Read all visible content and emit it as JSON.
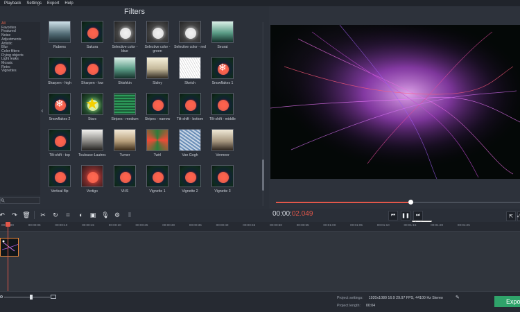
{
  "menu": [
    "Playback",
    "Settings",
    "Export",
    "Help"
  ],
  "filters_title": "Filters",
  "categories": [
    {
      "label": "All",
      "active": true
    },
    {
      "label": "Favorites"
    },
    {
      "label": "Featured"
    },
    {
      "label": "Noise"
    },
    {
      "label": "Adjustments"
    },
    {
      "label": "Artistic"
    },
    {
      "label": "Blur"
    },
    {
      "label": "Color filters"
    },
    {
      "label": "Flying objects"
    },
    {
      "label": "Light leaks"
    },
    {
      "label": "Mosaic"
    },
    {
      "label": "Retro"
    },
    {
      "label": "Vignettes"
    }
  ],
  "filters": [
    {
      "label": "Rubens",
      "style": "gradient-blue"
    },
    {
      "label": "Sakura",
      "style": "flower"
    },
    {
      "label": "Selective color - blue",
      "style": "flower-gray"
    },
    {
      "label": "Selective color - green",
      "style": "flower-gray"
    },
    {
      "label": "Selective color - red",
      "style": "flower-gray"
    },
    {
      "label": "Seurat",
      "style": "gradient-teal"
    },
    {
      "label": "Sharpen - high",
      "style": "flower"
    },
    {
      "label": "Sharpen - low",
      "style": "flower"
    },
    {
      "label": "Shishkin",
      "style": "gradient-teal"
    },
    {
      "label": "Sisley",
      "style": "gradient-cream"
    },
    {
      "label": "Sketch",
      "style": "sketch"
    },
    {
      "label": "Snowflakes 1",
      "style": "flower"
    },
    {
      "label": "Snowflakes 2",
      "style": "flower"
    },
    {
      "label": "Stars",
      "style": "flower-green"
    },
    {
      "label": "Stripes - medium",
      "style": "stripes"
    },
    {
      "label": "Stripes - narrow",
      "style": "flower"
    },
    {
      "label": "Tilt-shift - bottom",
      "style": "flower"
    },
    {
      "label": "Tilt-shift - middle",
      "style": "flower"
    },
    {
      "label": "Tilt-shift - top",
      "style": "flower"
    },
    {
      "label": "Toulouse-Lautrec",
      "style": "gradient-gray"
    },
    {
      "label": "Turner",
      "style": "gradient-sepia"
    },
    {
      "label": "Twirl",
      "style": "twirl"
    },
    {
      "label": "Van Gogh",
      "style": "vangogh"
    },
    {
      "label": "Vermeer",
      "style": "gradient-warm"
    },
    {
      "label": "Vertical flip",
      "style": "flower"
    },
    {
      "label": "Vertigo",
      "style": "flower-red"
    },
    {
      "label": "VHS",
      "style": "flower"
    },
    {
      "label": "Vignette 1",
      "style": "flower"
    },
    {
      "label": "Vignette 2",
      "style": "flower"
    },
    {
      "label": "Vignette 3",
      "style": "flower"
    }
  ],
  "player": {
    "timecode_main": "00:00:",
    "timecode_red": "02.049",
    "progress": 0.55,
    "tooltip": "Play / Pause"
  },
  "timeline_ticks": [
    "00:00:00",
    "00:00:05",
    "00:00:10",
    "00:00:15",
    "00:00:20",
    "00:00:25",
    "00:00:30",
    "00:00:35",
    "00:00:40",
    "00:00:45",
    "00:00:50",
    "00:00:55",
    "00:01:00",
    "00:01:05",
    "00:01:10",
    "00:01:15",
    "00:01:20",
    "00:01:25"
  ],
  "project": {
    "settings_label": "Project settings:",
    "settings_value": "1920x1080 16:9 29.97 FPS, 44100 Hz Stereo",
    "length_label": "Project length:",
    "length_value": "00:04"
  },
  "export_label": "Export",
  "colors": {
    "accent": "#e2574a",
    "export": "#2fa36a"
  },
  "icons": [
    "search-icon",
    "undo-icon",
    "redo-icon",
    "delete-icon",
    "cut-icon",
    "rotate-icon",
    "crop-icon",
    "color-adjust-icon",
    "image-icon",
    "mic-icon",
    "settings-icon",
    "audio-levels-icon",
    "prev-icon",
    "pause-icon",
    "next-icon",
    "external-window-icon",
    "fullscreen-icon",
    "edit-icon"
  ]
}
